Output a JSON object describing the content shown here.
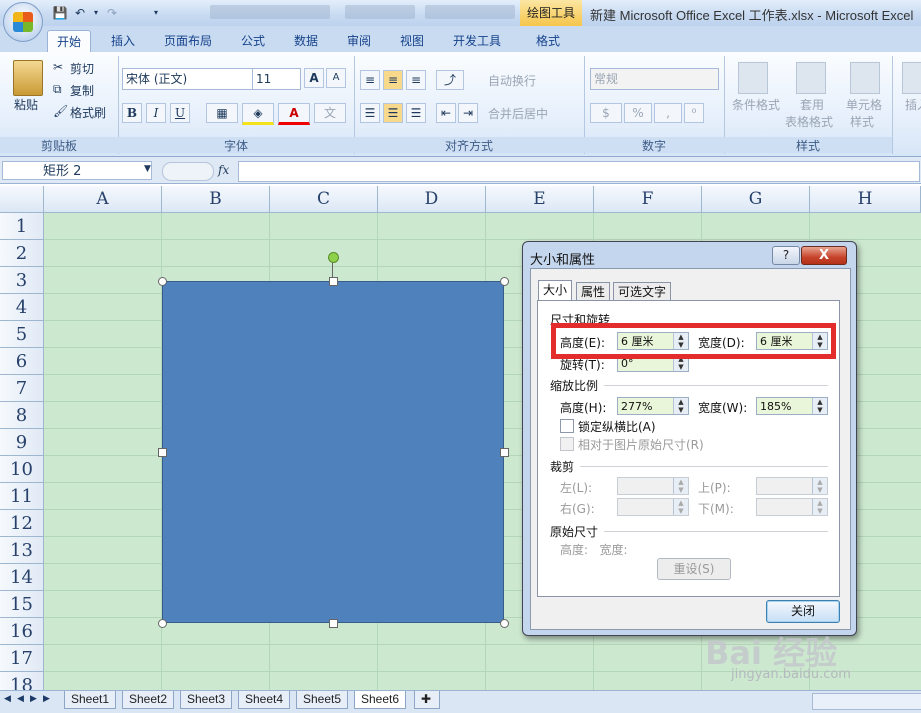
{
  "window": {
    "title": "新建 Microsoft Office Excel 工作表.xlsx - Microsoft Excel",
    "contextual_tab": "绘图工具"
  },
  "ribbon": {
    "tabs": [
      "开始",
      "插入",
      "页面布局",
      "公式",
      "数据",
      "审阅",
      "视图",
      "开发工具",
      "格式"
    ],
    "active_tab": "开始",
    "clipboard": {
      "paste": "粘贴",
      "cut": "剪切",
      "copy": "复制",
      "format_painter": "格式刷",
      "label": "剪贴板"
    },
    "font": {
      "name": "宋体 (正文)",
      "size": "11",
      "label": "字体",
      "bold": "B",
      "italic": "I",
      "underline": "U",
      "grow": "A",
      "shrink": "A"
    },
    "alignment": {
      "wrap": "自动换行",
      "merge": "合并后居中",
      "label": "对齐方式"
    },
    "number": {
      "format": "常规",
      "percent": "%",
      "label": "数字"
    },
    "styles": {
      "conditional": "条件格式",
      "table_line1": "套用",
      "table_line2": "表格格式",
      "cell_line1": "单元格",
      "cell_line2": "样式",
      "label": "样式"
    },
    "cells": {
      "insert": "插入"
    }
  },
  "formula_bar": {
    "name_box": "矩形 2",
    "fx": "fx"
  },
  "columns": [
    "A",
    "B",
    "C",
    "D",
    "E",
    "F",
    "G",
    "H"
  ],
  "rows": [
    "1",
    "2",
    "3",
    "4",
    "5",
    "6",
    "7",
    "8",
    "9",
    "10",
    "11",
    "12",
    "13",
    "14",
    "15",
    "16",
    "17",
    "18"
  ],
  "dialog": {
    "title": "大小和属性",
    "help": "?",
    "close_x": "X",
    "tabs": [
      "大小",
      "属性",
      "可选文字"
    ],
    "size_section": "尺寸和旋转",
    "height_label": "高度(E):",
    "height_value": "6 厘米",
    "width_label": "宽度(D):",
    "width_value": "6 厘米",
    "rotation_label": "旋转(T):",
    "rotation_value": "0°",
    "scale_section": "缩放比例",
    "scale_height_label": "高度(H):",
    "scale_height_value": "277%",
    "scale_width_label": "宽度(W):",
    "scale_width_value": "185%",
    "lock_aspect": "锁定纵横比(A)",
    "relative_original": "相对于图片原始尺寸(R)",
    "crop_section": "裁剪",
    "crop_left": "左(L):",
    "crop_top": "上(P):",
    "crop_right": "右(G):",
    "crop_bottom": "下(M):",
    "original_section": "原始尺寸",
    "original_text": "高度:   宽度:",
    "reset": "重设(S)",
    "close": "关闭"
  },
  "sheets": [
    "Sheet1",
    "Sheet2",
    "Sheet3",
    "Sheet4",
    "Sheet5",
    "Sheet6"
  ],
  "active_sheet": "Sheet6",
  "watermark": {
    "main": "Bai 经验",
    "sub": "jingyan.baidu.com"
  },
  "colors": {
    "shape_fill": "#4f81bd",
    "grid_bg": "#cce8cf",
    "highlight": "#e32c2c"
  }
}
